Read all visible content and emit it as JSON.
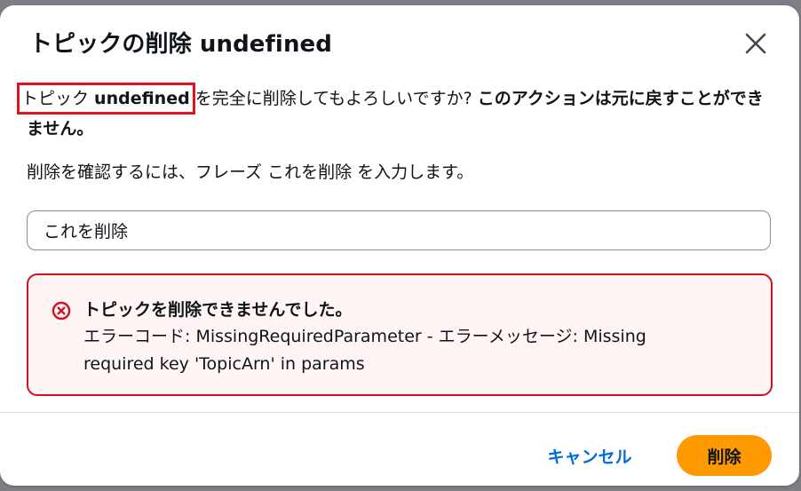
{
  "modal": {
    "title": "トピックの削除 undefined",
    "close_icon": "close-icon"
  },
  "body": {
    "topic_prefix": "トピック ",
    "topic_name": "undefined",
    "question": "を完全に削除してもよろしいですか? ",
    "warning": "このアクションは元に戻すことができません。"
  },
  "confirm": {
    "hint_before": "削除を確認するには、フレーズ ",
    "phrase": "これを削除",
    "hint_after": " を入力します。",
    "input_value": "これを削除"
  },
  "error": {
    "icon": "error-x-icon",
    "title": "トピックを削除できませんでした。",
    "message": "エラーコード: MissingRequiredParameter - エラーメッセージ: Missing required key 'TopicArn' in params",
    "color": "#d0101e"
  },
  "footer": {
    "cancel_label": "キャンセル",
    "delete_label": "削除"
  },
  "colors": {
    "accent": "#ff9900",
    "link": "#006ce0",
    "highlight_border": "#e0141f"
  }
}
